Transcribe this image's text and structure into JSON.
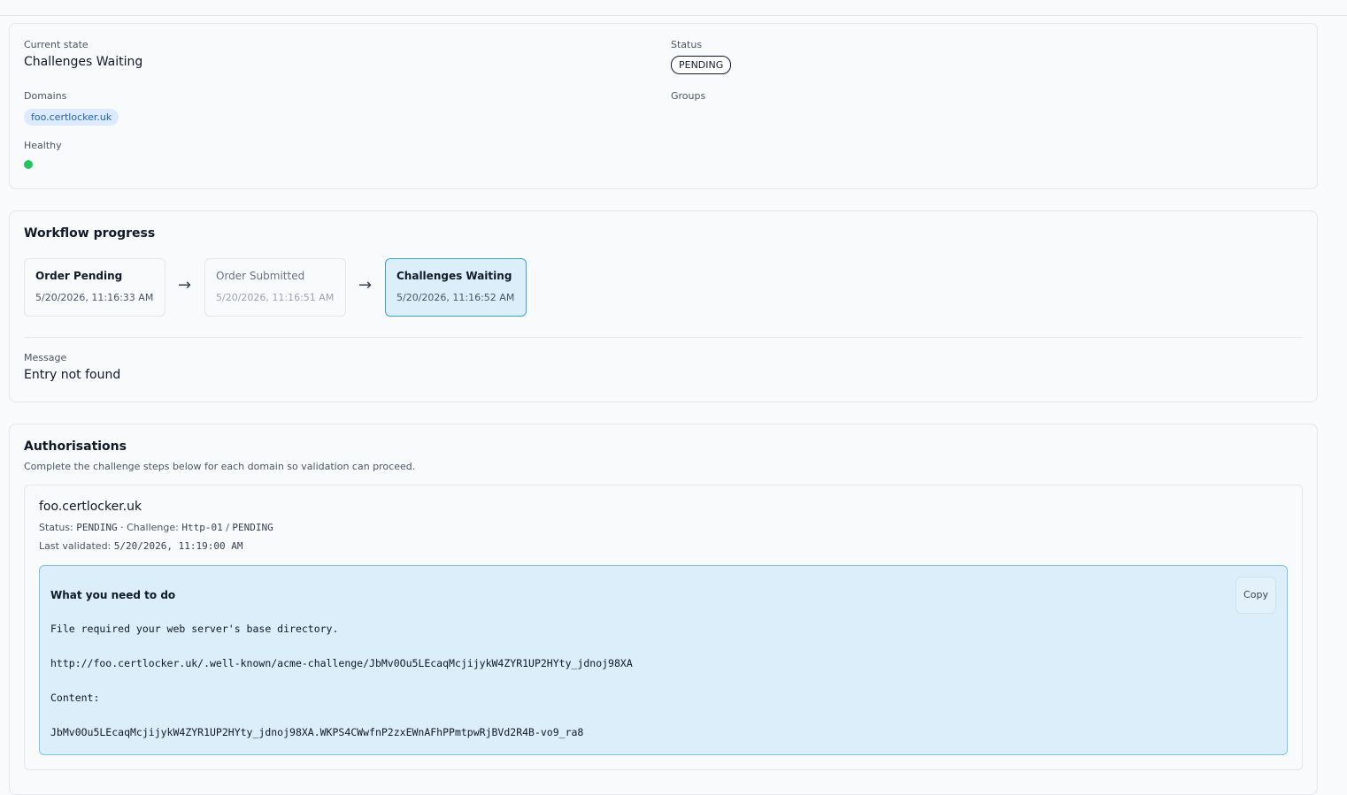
{
  "summary": {
    "current_state_label": "Current state",
    "current_state_value": "Challenges Waiting",
    "status_label": "Status",
    "status_value": "PENDING",
    "domains_label": "Domains",
    "domains": [
      "foo.certlocker.uk"
    ],
    "groups_label": "Groups",
    "healthy_label": "Healthy",
    "healthy_color": "#22c55e"
  },
  "workflow": {
    "title": "Workflow progress",
    "steps": [
      {
        "name": "Order Pending",
        "time": "5/20/2026, 11:16:33 AM",
        "state": "completed"
      },
      {
        "name": "Order Submitted",
        "time": "5/20/2026, 11:16:51 AM",
        "state": "muted"
      },
      {
        "name": "Challenges Waiting",
        "time": "5/20/2026, 11:16:52 AM",
        "state": "active"
      }
    ],
    "message_label": "Message",
    "message_value": "Entry not found"
  },
  "authorisations": {
    "title": "Authorisations",
    "subtitle": "Complete the challenge steps below for each domain so validation can proceed.",
    "items": [
      {
        "domain": "foo.certlocker.uk",
        "status_label": "Status:",
        "status_value": "PENDING",
        "challenge_label": "· Challenge:",
        "challenge_type": "Http-01",
        "challenge_sep": "/",
        "challenge_status": "PENDING",
        "last_validated_label": "Last validated:",
        "last_validated_value": "5/20/2026, 11:19:00 AM",
        "instructions_title": "What you need to do",
        "copy_label": "Copy",
        "lines": [
          "File required your web server's base directory.",
          "http://foo.certlocker.uk/.well-known/acme-challenge/JbMv0Ou5LEcaqMcjijykW4ZYR1UP2HYty_jdnoj98XA",
          "Content:",
          "JbMv0Ou5LEcaqMcjijykW4ZYR1UP2HYty_jdnoj98XA.WKPS4CWwfnP2zxEWnAFhPPmtpwRjBVd2R4B-vo9_ra8"
        ]
      }
    ]
  }
}
